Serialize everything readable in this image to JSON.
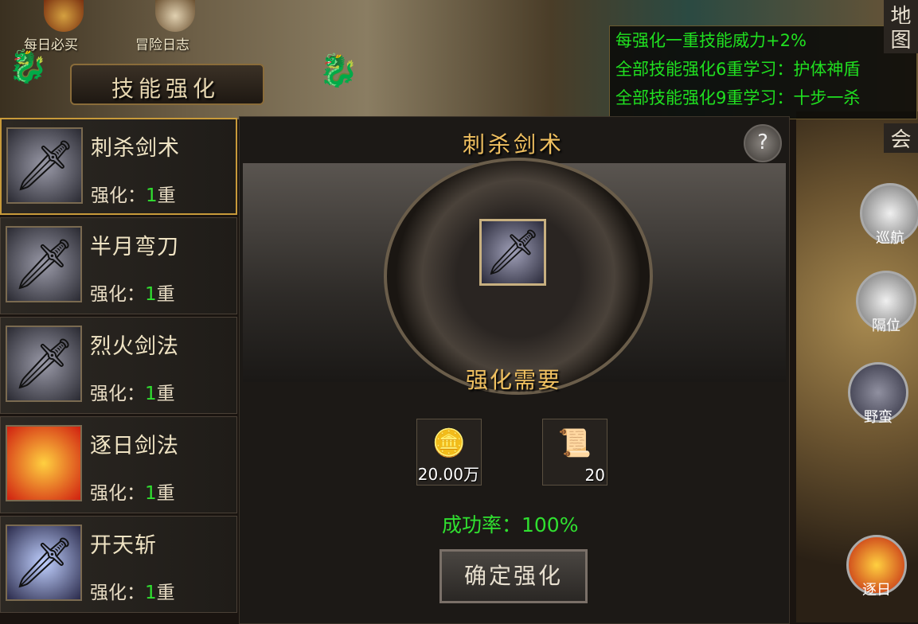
{
  "top": {
    "daily_label": "每日必买",
    "adventure_label": "冒险日志"
  },
  "title": "技能强化",
  "tooltip": {
    "lines": [
      "每强化一重技能威力+2%",
      "全部技能强化6重学习：护体神盾",
      "全部技能强化9重学习：十步一杀"
    ]
  },
  "right_tabs": [
    "地",
    "图",
    "会"
  ],
  "skills": [
    {
      "name": "刺杀剑术",
      "level_label": "强化：",
      "level": "1",
      "level_suffix": "重"
    },
    {
      "name": "半月弯刀",
      "level_label": "强化：",
      "level": "1",
      "level_suffix": "重"
    },
    {
      "name": "烈火剑法",
      "level_label": "强化：",
      "level": "1",
      "level_suffix": "重"
    },
    {
      "name": "逐日剑法",
      "level_label": "强化：",
      "level": "1",
      "level_suffix": "重"
    },
    {
      "name": "开天斩",
      "level_label": "强化：",
      "level": "1",
      "level_suffix": "重"
    }
  ],
  "detail": {
    "skill_name": "刺杀剑术",
    "help": "?",
    "requirement_title": "强化需要",
    "items": [
      {
        "icon": "gold-ingot-icon",
        "count": "20.00万"
      },
      {
        "icon": "scroll-icon",
        "count": "20"
      }
    ],
    "success_rate": "成功率：100%",
    "confirm_label": "确定强化"
  },
  "side_buttons": [
    "巡航",
    "隔位",
    "野蛮",
    "逐日"
  ]
}
